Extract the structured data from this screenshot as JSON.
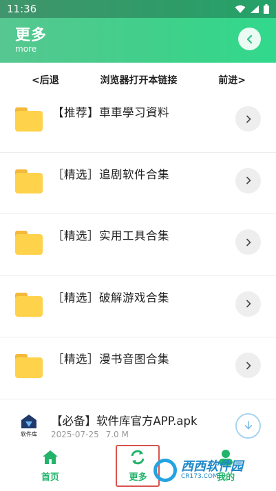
{
  "status_bar": {
    "time": "11:36"
  },
  "header": {
    "title": "更多",
    "subtitle": "more"
  },
  "browser_bar": {
    "back": "<后退",
    "open": "浏览器打开本链接",
    "forward": "前进>"
  },
  "items": [
    {
      "label": "【推荐】車車學习資料",
      "icon": "folder-icon"
    },
    {
      "label": "［精选］追剧软件合集",
      "icon": "folder-icon"
    },
    {
      "label": "［精选］实用工具合集",
      "icon": "folder-icon"
    },
    {
      "label": "［精选］破解游戏合集",
      "icon": "folder-icon"
    },
    {
      "label": "［精选］漫书音图合集",
      "icon": "folder-icon"
    }
  ],
  "apk": {
    "title": "【必备】软件库官方APP.apk",
    "date": "2025-07-25",
    "size": "7.0 M",
    "logo_text": "软件库"
  },
  "bottom_nav": [
    {
      "label": "首页",
      "icon": "home-icon"
    },
    {
      "label": "更多",
      "icon": "refresh-icon"
    },
    {
      "label": "我的",
      "icon": "user-icon"
    }
  ],
  "watermark": {
    "text": "西西软件园",
    "url": "CR173.COM"
  },
  "colors": {
    "accent": "#3fd08a",
    "nav": "#22b46a",
    "folder": "#ffd24c"
  }
}
